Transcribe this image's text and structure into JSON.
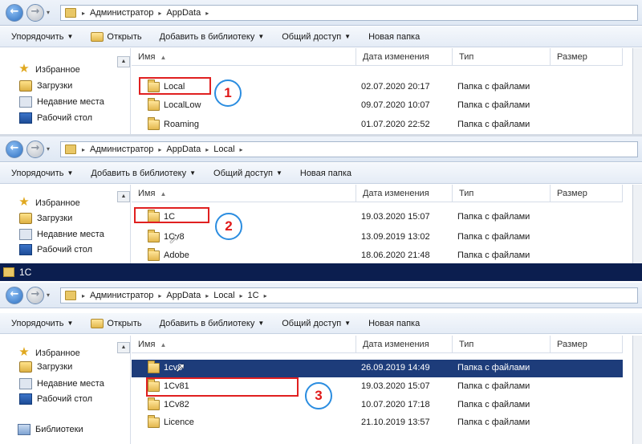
{
  "common": {
    "back_glyph": "←",
    "fwd_glyph": "→",
    "hist_glyph": "▾",
    "sep": "▸",
    "dd": "▼",
    "sort": "▲",
    "toolbar": {
      "organize": "Упорядочить",
      "open": "Открыть",
      "add_library": "Добавить в библиотеку",
      "share": "Общий доступ",
      "new_folder": "Новая папка"
    },
    "columns": {
      "name": "Имя",
      "date": "Дата изменения",
      "type": "Тип",
      "size": "Размер"
    },
    "nav": {
      "favorites": "Избранное",
      "downloads": "Загрузки",
      "recent": "Недавние места",
      "desktop": "Рабочий стол",
      "libraries": "Библиотеки"
    }
  },
  "panel1": {
    "crumbs": [
      "Администратор",
      "AppData"
    ],
    "rows": [
      {
        "name": "Local",
        "date": "02.07.2020 20:17",
        "type": "Папка с файлами"
      },
      {
        "name": "LocalLow",
        "date": "09.07.2020 10:07",
        "type": "Папка с файлами"
      },
      {
        "name": "Roaming",
        "date": "01.07.2020 22:52",
        "type": "Папка с файлами"
      }
    ],
    "badge": "1"
  },
  "panel2": {
    "crumbs": [
      "Администратор",
      "AppData",
      "Local"
    ],
    "rows": [
      {
        "name": "1C",
        "date": "19.03.2020 15:07",
        "type": "Папка с файлами"
      },
      {
        "name": "1Cv8",
        "date": "13.09.2019 13:02",
        "type": "Папка с файлами"
      },
      {
        "name": "Adobe",
        "date": "18.06.2020 21:48",
        "type": "Папка с файлами"
      }
    ],
    "badge": "2"
  },
  "window_title": "1C",
  "panel3": {
    "crumbs": [
      "Администратор",
      "AppData",
      "Local",
      "1C"
    ],
    "rows": [
      {
        "name": "1cv8",
        "date": "26.09.2019 14:49",
        "type": "Папка с файлами"
      },
      {
        "name": "1Cv81",
        "date": "19.03.2020 15:07",
        "type": "Папка с файлами"
      },
      {
        "name": "1Cv82",
        "date": "10.07.2020 17:18",
        "type": "Папка с файлами"
      },
      {
        "name": "Licence",
        "date": "21.10.2019 13:57",
        "type": "Папка с файлами"
      }
    ],
    "badge": "3"
  },
  "colors": {
    "highlight": "#e02020",
    "badge_ring": "#2b8de0",
    "selection": "#1d3c7a",
    "titlebar": "#0b1e4f"
  }
}
